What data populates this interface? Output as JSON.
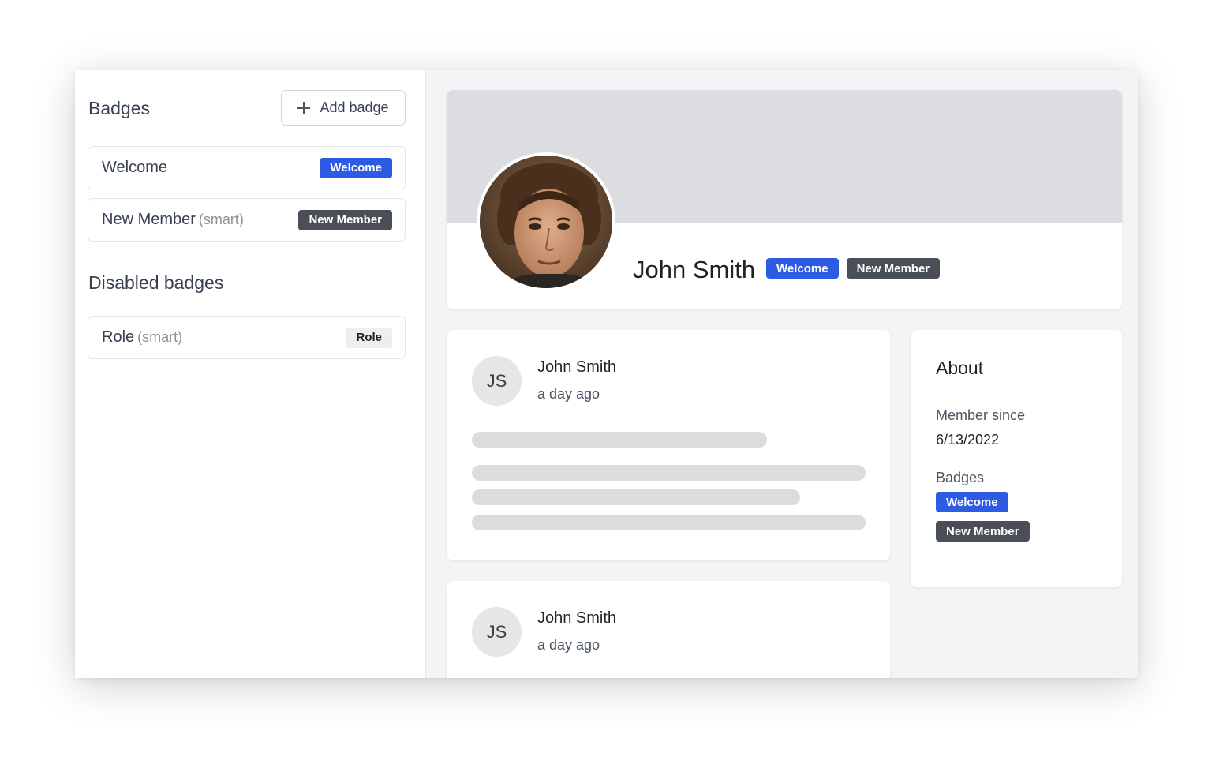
{
  "sidebar": {
    "title": "Badges",
    "add_button_label": "Add badge",
    "badges": [
      {
        "name": "Welcome",
        "suffix": "",
        "badge_label": "Welcome",
        "color": "#2d5be3"
      },
      {
        "name": "New Member",
        "suffix": "(smart)",
        "badge_label": "New Member",
        "color": "#4a4f57"
      }
    ],
    "disabled_title": "Disabled badges",
    "disabled_badges": [
      {
        "name": "Role",
        "suffix": "(smart)",
        "badge_label": "Role",
        "color": "#eeeeee"
      }
    ]
  },
  "profile": {
    "name": "John Smith",
    "badges": [
      {
        "label": "Welcome",
        "color": "#2d5be3"
      },
      {
        "label": "New Member",
        "color": "#4a4f57"
      }
    ]
  },
  "posts": [
    {
      "initials": "JS",
      "author": "John Smith",
      "time": "a day ago"
    },
    {
      "initials": "JS",
      "author": "John Smith",
      "time": "a day ago"
    }
  ],
  "about": {
    "title": "About",
    "member_since_label": "Member since",
    "member_since_value": "6/13/2022",
    "badges_label": "Badges",
    "badges": [
      {
        "label": "Welcome",
        "color": "#2d5be3"
      },
      {
        "label": "New Member",
        "color": "#4a4f57"
      }
    ]
  },
  "icons": {
    "add": "plus-icon",
    "avatar": "user-photo"
  }
}
